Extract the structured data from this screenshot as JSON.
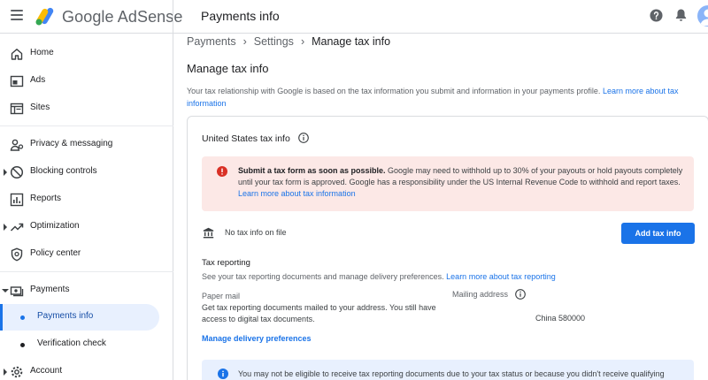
{
  "app": {
    "brand": "Google AdSense",
    "page_title": "Payments info"
  },
  "colors": {
    "accent": "#1a73e8",
    "alert_bg": "#fce8e6",
    "alert_icon": "#d93025",
    "info_bg": "#e8f0fe"
  },
  "icons": {
    "menu": "menu-icon",
    "help": "help-icon",
    "notifications": "bell-icon",
    "account": "avatar"
  },
  "sidebar": {
    "items": [
      {
        "label": "Home",
        "icon": "home-icon"
      },
      {
        "label": "Ads",
        "icon": "ads-icon"
      },
      {
        "label": "Sites",
        "icon": "sites-icon"
      },
      {
        "label": "Privacy & messaging",
        "icon": "privacy-icon"
      },
      {
        "label": "Blocking controls",
        "icon": "block-icon"
      },
      {
        "label": "Reports",
        "icon": "reports-icon"
      },
      {
        "label": "Optimization",
        "icon": "optimization-icon"
      },
      {
        "label": "Policy center",
        "icon": "policy-icon"
      },
      {
        "label": "Payments",
        "icon": "payments-icon"
      },
      {
        "label": "Payments info",
        "icon": "dot"
      },
      {
        "label": "Verification check",
        "icon": "dot"
      },
      {
        "label": "Account",
        "icon": "gear-icon"
      }
    ]
  },
  "breadcrumb": [
    "Payments",
    "Settings",
    "Manage tax info"
  ],
  "main": {
    "heading": "Manage tax info",
    "intro_text": "Your tax relationship with Google is based on the tax information you submit and information in your payments profile. ",
    "intro_link": "Learn more about tax information"
  },
  "card": {
    "title": "United States tax info",
    "alert": {
      "bold": "Submit a tax form as soon as possible.",
      "text": " Google may need to withhold up to 30% of your payouts or hold payouts completely until your tax form is approved. Google has a responsibility under the US Internal Revenue Code to withhold and report taxes. ",
      "link": "Learn more about tax information"
    },
    "no_tax_info": "No tax info on file",
    "add_button": "Add tax info",
    "tax_reporting": {
      "title": "Tax reporting",
      "desc": "See your tax reporting documents and manage delivery preferences. ",
      "link": "Learn more about tax reporting"
    },
    "paper_mail": {
      "title": "Paper mail",
      "desc": "Get tax reporting documents mailed to your address. You still have access to digital tax documents."
    },
    "mailing_address": {
      "title": "Mailing address",
      "value": "China 580000"
    },
    "manage_link": "Manage delivery preferences",
    "info_banner": "You may not be eligible to receive tax reporting documents due to your tax status or because you didn't receive qualifying"
  }
}
